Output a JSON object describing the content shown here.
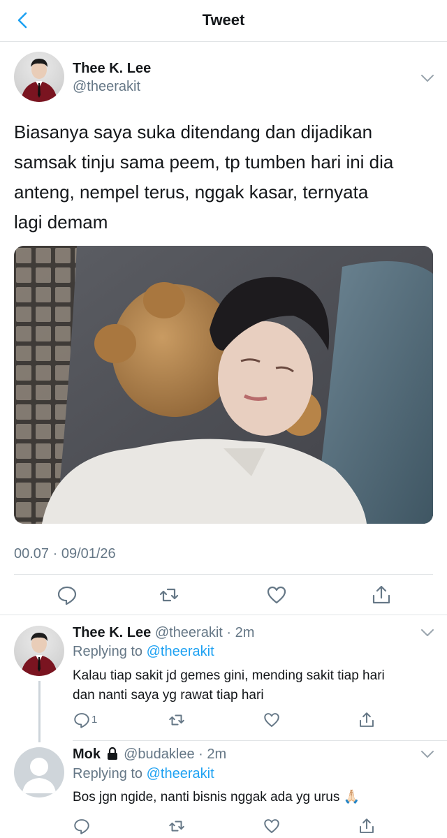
{
  "header": {
    "title": "Tweet"
  },
  "tweet": {
    "author_name": "Thee K. Lee",
    "author_handle": "@theerakit",
    "text_lines": [
      "Biasanya saya suka ditendang dan dijadikan",
      "samsak tinju sama peem, tp tumben hari ini dia",
      "anteng, nempel terus, nggak kasar, ternyata",
      "lagi demam"
    ],
    "timestamp": "00.07 · 09/01/26"
  },
  "replies": [
    {
      "name": "Thee K. Lee",
      "handle_time": "@theerakit · 2m",
      "replying_label": "Replying to",
      "replying_to": "@theerakit",
      "text_lines": [
        "Kalau tiap sakit jd gemes gini, mending sakit tiap hari",
        "dan nanti saya yg rawat tiap hari"
      ],
      "reply_count": "1"
    },
    {
      "name": "Mok",
      "handle_time": "@budaklee · 2m",
      "replying_label": "Replying to",
      "replying_to": "@theerakit",
      "text_lines": [
        "Bos jgn ngide, nanti bisnis nggak ada yg urus 🙏🏻"
      ]
    }
  ],
  "icons": {
    "back": "chevron-left-icon",
    "more": "chevron-down-icon",
    "reply": "speech-bubble-icon",
    "retweet": "retweet-icon",
    "like": "heart-icon",
    "share": "share-upload-icon",
    "lock": "lock-icon"
  },
  "colors": {
    "accent": "#1da1f2",
    "text_primary": "#14171a",
    "text_secondary": "#657786",
    "divider": "#e1e4e6"
  }
}
